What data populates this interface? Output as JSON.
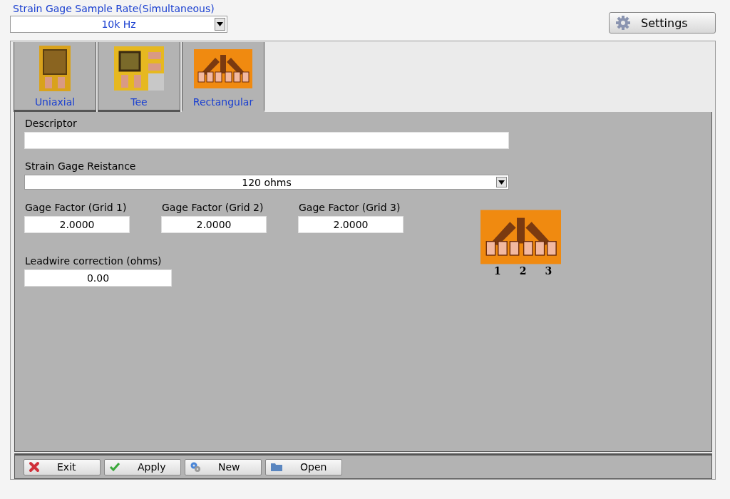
{
  "sample_rate": {
    "label": "Strain Gage Sample Rate(Simultaneous)",
    "value": "10k Hz"
  },
  "settings_button": {
    "label": "Settings"
  },
  "tabs": [
    {
      "label": "Uniaxial",
      "kind": "uniaxial",
      "selected": false
    },
    {
      "label": "Tee",
      "kind": "tee",
      "selected": false
    },
    {
      "label": "Rectangular",
      "kind": "rectangular",
      "selected": true
    }
  ],
  "descriptor": {
    "label": "Descriptor"
  },
  "resistance": {
    "label": "Strain Gage Reistance",
    "value": "120 ohms"
  },
  "gage_factors": [
    {
      "label": "Gage Factor (Grid 1)",
      "value": "2.0000"
    },
    {
      "label": "Gage Factor (Grid 2)",
      "value": "2.0000"
    },
    {
      "label": "Gage Factor (Grid 3)",
      "value": "2.0000"
    }
  ],
  "leadwire": {
    "label": "Leadwire correction (ohms)",
    "value": "0.00"
  },
  "grid_labels": [
    "1",
    "2",
    "3"
  ],
  "buttons": [
    {
      "label": "Exit",
      "kind": "exit"
    },
    {
      "label": "Apply",
      "kind": "apply"
    },
    {
      "label": "New",
      "kind": "new"
    },
    {
      "label": "Open",
      "kind": "open"
    }
  ]
}
